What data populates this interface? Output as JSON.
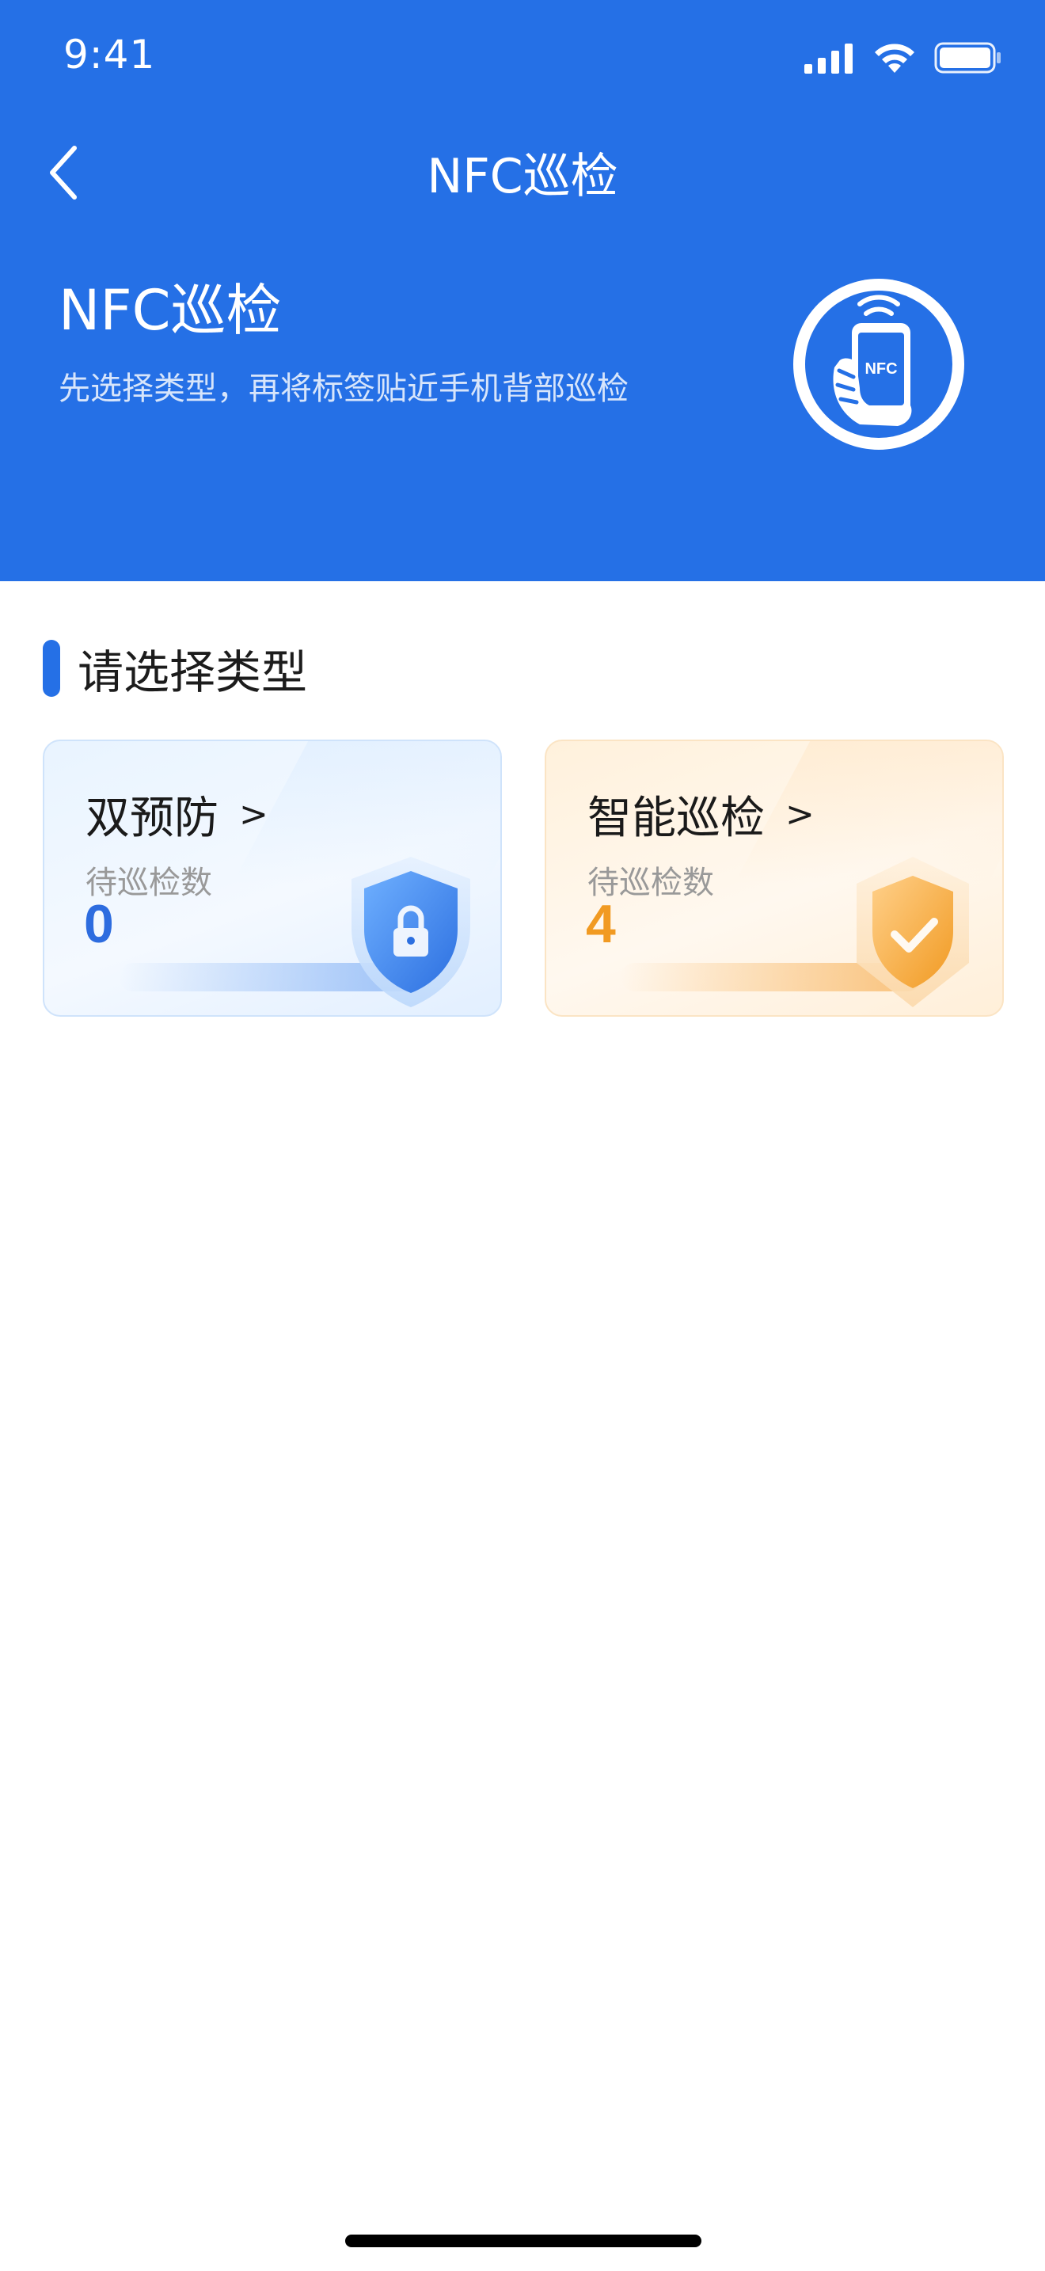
{
  "status_bar": {
    "time": "9:41"
  },
  "nav": {
    "title": "NFC巡检"
  },
  "hero": {
    "title": "NFC巡检",
    "subtitle": "先选择类型，再将标签贴近手机背部巡检",
    "badge_text": "NFC"
  },
  "section": {
    "title": "请选择类型"
  },
  "cards": [
    {
      "title": "双预防",
      "arrow": ">",
      "label": "待巡检数",
      "count": "0",
      "icon": "shield-lock-icon"
    },
    {
      "title": "智能巡检",
      "arrow": ">",
      "label": "待巡检数",
      "count": "4",
      "icon": "shield-check-icon"
    }
  ],
  "colors": {
    "primary": "#2570E6",
    "blue_count": "#2d6cdf",
    "orange_count": "#f19a22"
  }
}
